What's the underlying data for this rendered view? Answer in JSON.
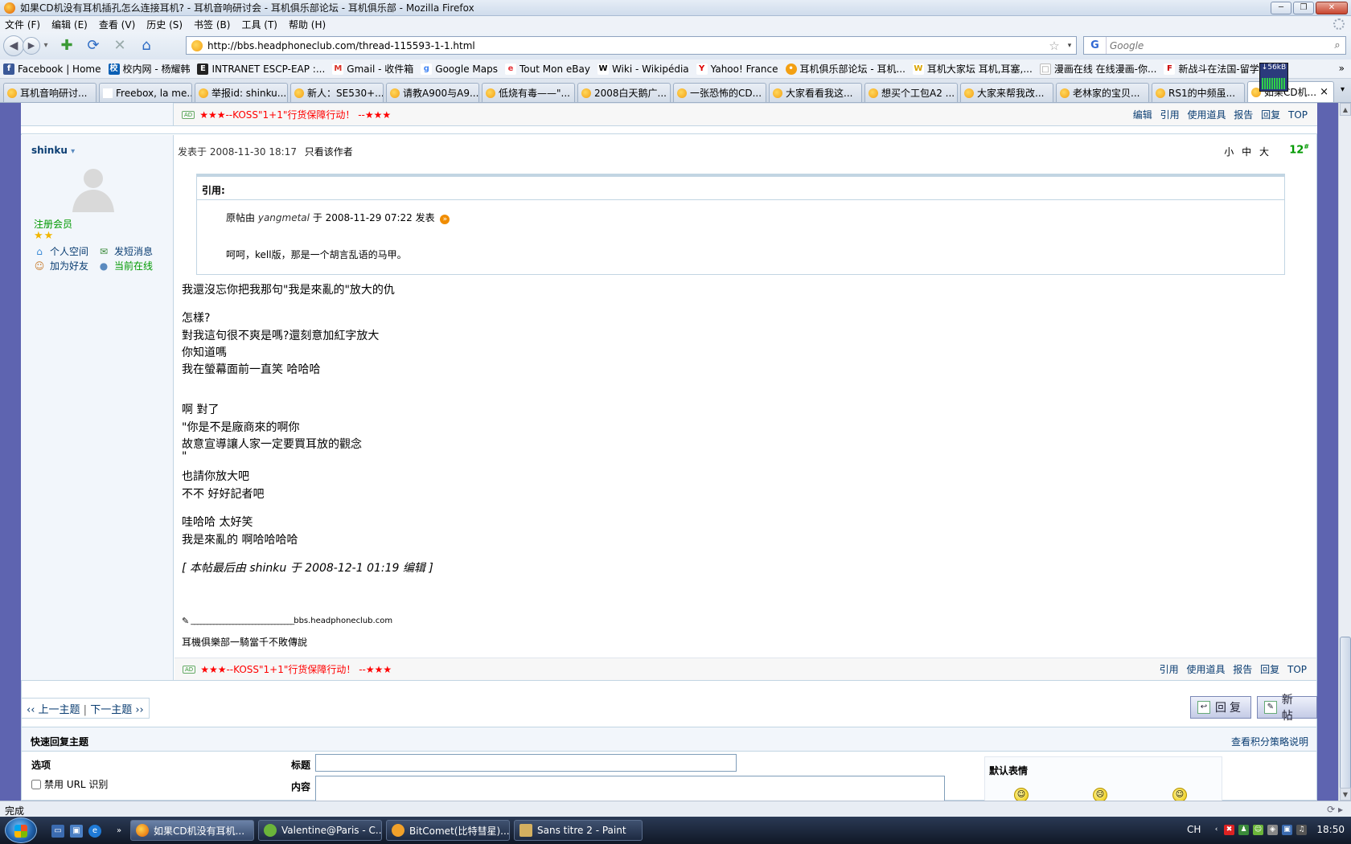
{
  "window": {
    "title": "如果CD机没有耳机插孔怎么连接耳机? - 耳机音响研讨会 - 耳机俱乐部论坛 - 耳机俱乐部 - Mozilla Firefox"
  },
  "menu": [
    "文件 (F)",
    "编辑 (E)",
    "查看 (V)",
    "历史 (S)",
    "书签 (B)",
    "工具 (T)",
    "帮助 (H)"
  ],
  "nav": {
    "url": "http://bbs.headphoneclub.com/thread-115593-1-1.html",
    "search_placeholder": "Google",
    "search_engine": "G"
  },
  "bookmarks": [
    {
      "label": "Facebook | Home",
      "icon": "f",
      "color": "#3b5998"
    },
    {
      "label": "校内网 - 杨耀韩",
      "icon": "校",
      "color": "#0a5fb4"
    },
    {
      "label": "INTRANET ESCP-EAP :...",
      "icon": "E",
      "color": "#222"
    },
    {
      "label": "Gmail - 收件箱",
      "icon": "M",
      "color": "#d93025"
    },
    {
      "label": "Google Maps",
      "icon": "g",
      "color": "#4285f4"
    },
    {
      "label": "Tout Mon eBay",
      "icon": "e",
      "color": "#e53238"
    },
    {
      "label": "Wiki - Wikipédia",
      "icon": "W",
      "color": "#000"
    },
    {
      "label": "Yahoo! France",
      "icon": "Y",
      "color": "#d00"
    },
    {
      "label": "耳机俱乐部论坛 - 耳机...",
      "icon": "•",
      "color": "#f3a013"
    },
    {
      "label": "耳机大家坛 耳机,耳塞,...",
      "icon": "W",
      "color": "#d9a400"
    },
    {
      "label": "漫画在线 在线漫画-你...",
      "icon": "□",
      "color": "#ddd"
    },
    {
      "label": "新战斗在法国-留学法...",
      "icon": "F",
      "color": "#c00"
    }
  ],
  "bookmarks_more": "»",
  "netmeter": "↓56kB",
  "tabs": [
    {
      "label": "耳机音响研讨...",
      "active": false
    },
    {
      "label": "Freebox, la me...",
      "active": false
    },
    {
      "label": "举报id: shinku...",
      "active": false
    },
    {
      "label": "新人：SE530+...",
      "active": false
    },
    {
      "label": "请教A900与A9...",
      "active": false
    },
    {
      "label": "低烧有毒——\"...",
      "active": false
    },
    {
      "label": "2008白天鹅广...",
      "active": false
    },
    {
      "label": "一张恐怖的CD...",
      "active": false
    },
    {
      "label": "大家看看我这...",
      "active": false
    },
    {
      "label": "想买个工包A2 ...",
      "active": false
    },
    {
      "label": "大家来帮我改...",
      "active": false
    },
    {
      "label": "老林家的宝贝...",
      "active": false
    },
    {
      "label": "RS1的中频虽...",
      "active": false
    },
    {
      "label": "如果CD机...",
      "active": true
    }
  ],
  "tab_close": "×",
  "prev_post": {
    "ad_badge": "AD",
    "ad_text": "★★★--KOSS\"1+1\"行货保障行动！ --★★★",
    "links": [
      "编辑",
      "引用",
      "使用道具",
      "报告",
      "回复",
      "TOP"
    ]
  },
  "post": {
    "author": "shinku",
    "author_arrow": "▾",
    "user_group": "注册会员",
    "stars": "★★",
    "actions": [
      {
        "label": "个人空间",
        "icon": "⌂",
        "active": false
      },
      {
        "label": "发短消息",
        "icon": "✉",
        "active": false
      },
      {
        "label": "加为好友",
        "icon": "☺",
        "active": false
      },
      {
        "label": "当前在线",
        "icon": "●",
        "active": true
      }
    ],
    "posted_at": "发表于 2008-11-30 18:17",
    "only_author": "只看该作者",
    "font_sizes": [
      "小",
      "中",
      "大"
    ],
    "floor": "12",
    "floor_sup": "#",
    "quote": {
      "label": "引用:",
      "orig_prefix": "原帖由",
      "orig_user": "yangmetal",
      "orig_suffix": "于 2008-11-29 07:22 发表",
      "arrow": "»",
      "text": "呵呵，kell版，那是一个胡言乱语的马甲。"
    },
    "lines": [
      "我還沒忘你把我那句\"我是來亂的\"放大的仇",
      "怎樣?",
      "對我這句很不爽是嗎?還刻意加紅字放大",
      "你知道嗎",
      "我在螢幕面前一直笑 哈哈哈",
      "啊  對了",
      "\"你是不是廠商來的啊你",
      "故意宣導讓人家一定要買耳放的觀念",
      "\"",
      "也請你放大吧",
      "不不  好好記者吧",
      "哇哈哈 太好笑",
      "我是來亂的 啊哈哈哈哈"
    ],
    "edit_note": "[ 本帖最后由 shinku 于 2008-12-1 01:19 编辑 ]",
    "sig_pen": "✎",
    "sig_dashes": "________________________________",
    "sig_site": "bbs.headphoneclub.com",
    "sig_text": "耳機俱樂部一騎當千不敗傳說",
    "ad_badge": "AD",
    "ad_text": "★★★--KOSS\"1+1\"行货保障行动！ --★★★",
    "links": [
      "引用",
      "使用道具",
      "报告",
      "回复",
      "TOP"
    ]
  },
  "pagenav": {
    "prev": "‹‹ 上一主题",
    "sep": "|",
    "next": "下一主题 ››"
  },
  "buttons": {
    "reply": "回复",
    "reply_icon": "↩",
    "newpost": "新帖",
    "newpost_icon": "✎"
  },
  "quickreply": {
    "title": "快速回复主题",
    "help": "查看积分策略说明",
    "options": "选项",
    "disable_url": "禁用 URL 识别",
    "subject_label": "标题",
    "content_label": "内容",
    "smiley_header": "默认表情",
    "smileys": [
      "☺",
      "☹",
      "☺"
    ]
  },
  "statusbar": {
    "text": "完成",
    "right": "⟳ ▸"
  },
  "taskbar": {
    "quicklaunch": [
      "▭",
      "▣",
      "e",
      "»"
    ],
    "tasks": [
      {
        "label": "如果CD机没有耳机...",
        "color": "#e86a10",
        "active": true
      },
      {
        "label": "Valentine@Paris - C...",
        "color": "#6bb53a",
        "active": false
      },
      {
        "label": "BitComet(比特彗星)...",
        "color": "#f1a12a",
        "active": false
      },
      {
        "label": "Sans titre 2 - Paint",
        "color": "#d4b060",
        "active": false
      }
    ],
    "lang": "CH",
    "tray_icons": [
      "‹",
      "✖",
      "♟",
      "☺",
      "◈",
      "▣",
      "♫"
    ],
    "clock": "18:50"
  },
  "window_buttons": {
    "minimize": "─",
    "restore": "❐",
    "close": "✕"
  },
  "nav_icons": {
    "back": "◀",
    "forward": "▶",
    "dropdown": "▾",
    "newtab": "✚",
    "reload": "⟳",
    "stop": "✕",
    "home": "⌂",
    "star": "☆",
    "search": "⌕"
  },
  "colors": {
    "forum_bg": "#5e64b0",
    "link": "#0a3d72",
    "ad": "#ff0000",
    "online": "#009900"
  }
}
